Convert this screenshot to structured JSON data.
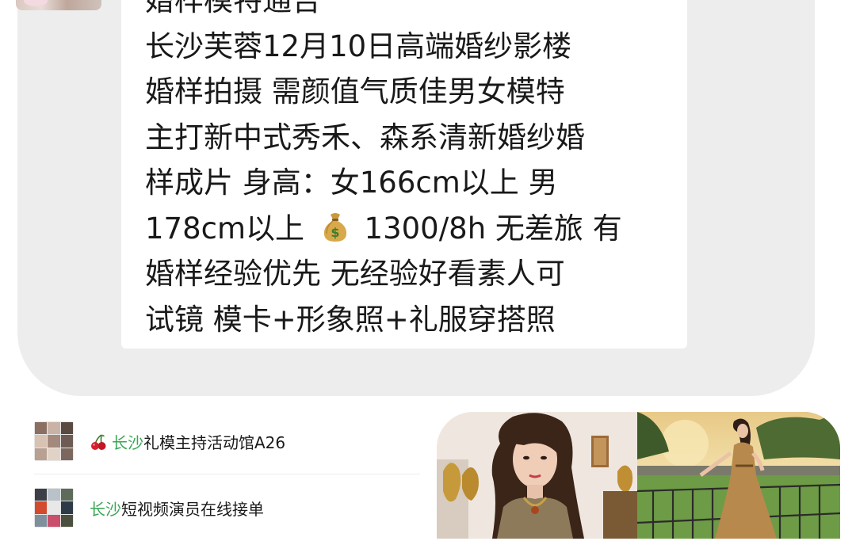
{
  "chat": {
    "message_lines": [
      "婚样模特通告",
      "长沙芙蓉12月10日高端婚纱影楼",
      "婚样拍摄 需颜值气质佳男女模特",
      "主打新中式秀禾、森系清新婚纱婚",
      "样成片 身高：女166cm以上 男",
      "178cm以上",
      "1300/8h 无差旅 有",
      "婚样经验优先 无经验好看素人可",
      "试镜 模卡+形象照+礼服穿搭照"
    ]
  },
  "list": {
    "items": [
      {
        "prefix_icon": "cherry-icon",
        "city": "长沙",
        "rest": "礼模主持活动馆A26"
      },
      {
        "prefix_icon": "",
        "city": "长沙",
        "rest": "短视频演员在线接单"
      }
    ]
  },
  "colors": {
    "panel_bg": "#ededed",
    "bubble_bg": "#ffffff",
    "city_green": "#3aa655"
  }
}
